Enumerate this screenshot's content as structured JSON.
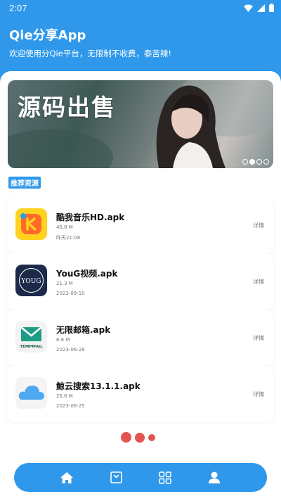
{
  "status_bar": {
    "time": "2:07",
    "icons": [
      "wifi-icon",
      "signal-icon",
      "battery-icon"
    ]
  },
  "header": {
    "title": "Qie分享App",
    "subtitle": "欢迎使用分Qie平台，无限制不收费，泰苦辣!"
  },
  "banner": {
    "text": "源码出售",
    "page_count": 4,
    "active_index": 1
  },
  "section": {
    "label": "推荐资源"
  },
  "apps": [
    {
      "name": "酷我音乐HD.apk",
      "size": "46.8 M",
      "date": "昨天21:08",
      "detail": "详情",
      "icon": "kuwo-music-icon"
    },
    {
      "name": "YouG视频.apk",
      "size": "21.3 M",
      "date": "2023-09-10",
      "detail": "详情",
      "icon": "youg-video-icon"
    },
    {
      "name": "无限邮箱.apk",
      "size": "6.8 M",
      "date": "2023-06-28",
      "detail": "详情",
      "icon": "temp-mail-icon"
    },
    {
      "name": "鲸云搜索13.1.1.apk",
      "size": "26.6 M",
      "date": "2023-06-25",
      "detail": "详情",
      "icon": "cloud-search-icon"
    }
  ],
  "icon_labels": {
    "youg": "YOUG",
    "tempmail": "TEMPMAIL"
  },
  "bottom_nav": {
    "items": [
      "home-icon",
      "inbox-icon",
      "grid-icon",
      "user-icon"
    ]
  },
  "colors": {
    "primary": "#2f98ea",
    "loading": "#e4534e"
  }
}
